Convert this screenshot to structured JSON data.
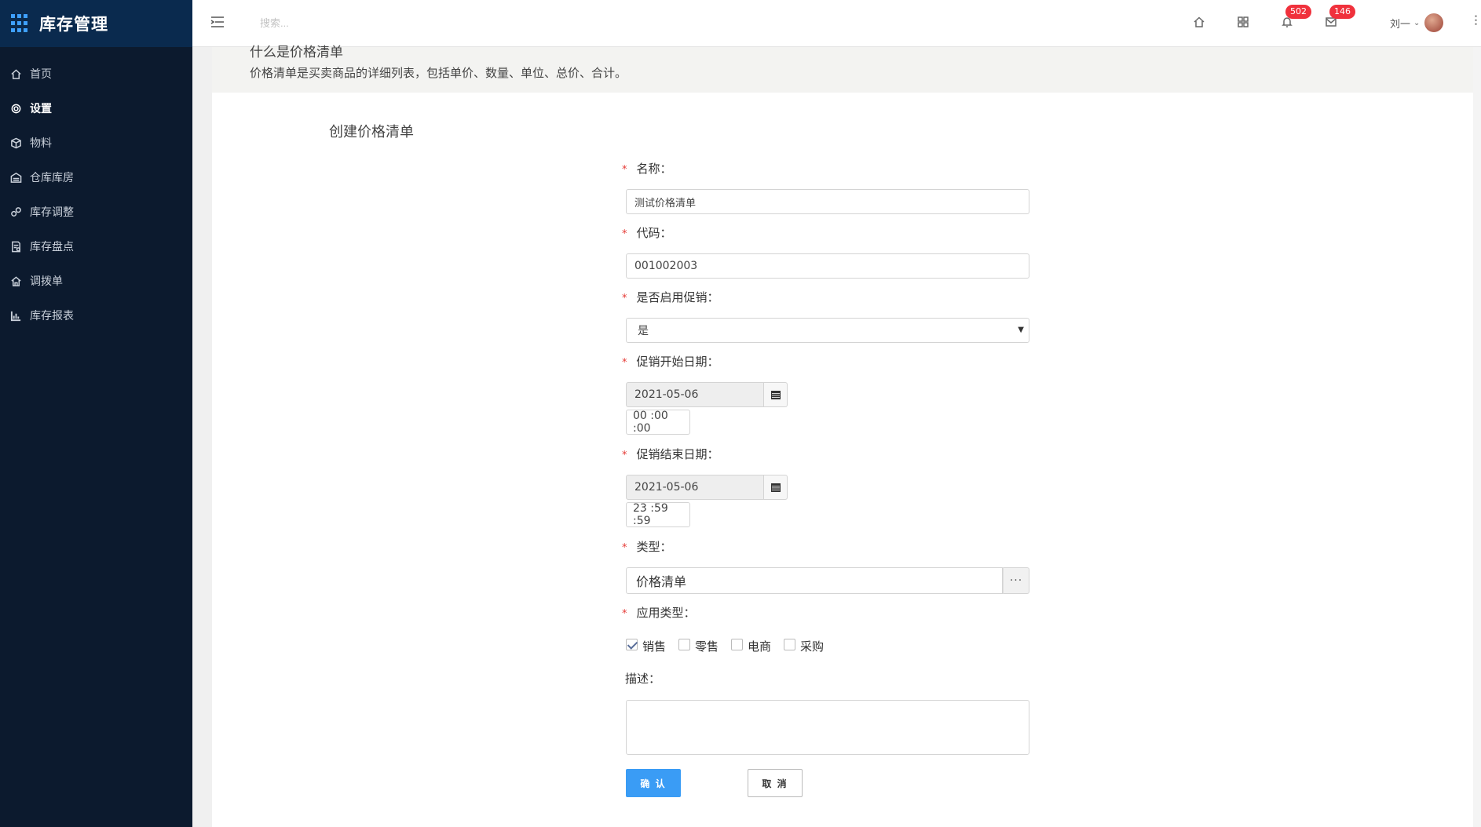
{
  "app": {
    "title": "库存管理",
    "brand_color": "#0a2a4e",
    "accent": "#3ea0ff"
  },
  "sidebar": {
    "items": [
      {
        "label": "首页",
        "icon": "home-icon",
        "active": false
      },
      {
        "label": "设置",
        "icon": "gear-icon",
        "active": true
      },
      {
        "label": "物料",
        "icon": "cube-icon",
        "active": false
      },
      {
        "label": "仓库库房",
        "icon": "warehouse-icon",
        "active": false
      },
      {
        "label": "库存调整",
        "icon": "adjust-icon",
        "active": false
      },
      {
        "label": "库存盘点",
        "icon": "inventory-check-icon",
        "active": false
      },
      {
        "label": "调拨单",
        "icon": "transfer-icon",
        "active": false
      },
      {
        "label": "库存报表",
        "icon": "bar-chart-icon",
        "active": false
      }
    ]
  },
  "topbar": {
    "search_placeholder": "搜索...",
    "notifications_count": "502",
    "messages_count": "146",
    "user_name": "刘一"
  },
  "info": {
    "title": "什么是价格清单",
    "description": "价格清单是买卖商品的详细列表，包括单价、数量、单位、总价、合计。"
  },
  "form": {
    "title": "创建价格清单",
    "name_label": "名称：",
    "name_value": "测试价格清单",
    "code_label": "代码：",
    "code_value": "001002003",
    "promo_label": "是否启用促销：",
    "promo_value": "是",
    "start_label": "促销开始日期：",
    "start_date": "2021-05-06",
    "start_time": "00 :00 :00",
    "end_label": "促销结束日期：",
    "end_date": "2021-05-06",
    "end_time": "23 :59 :59",
    "type_label": "类型：",
    "type_value": "价格清单",
    "type_button": "···",
    "app_type_label": "应用类型：",
    "app_types": [
      {
        "label": "销售",
        "checked": true
      },
      {
        "label": "零售",
        "checked": false
      },
      {
        "label": "电商",
        "checked": false
      },
      {
        "label": "采购",
        "checked": false
      }
    ],
    "desc_label": "描述：",
    "desc_value": "",
    "confirm_label": "确 认",
    "cancel_label": "取 消"
  }
}
